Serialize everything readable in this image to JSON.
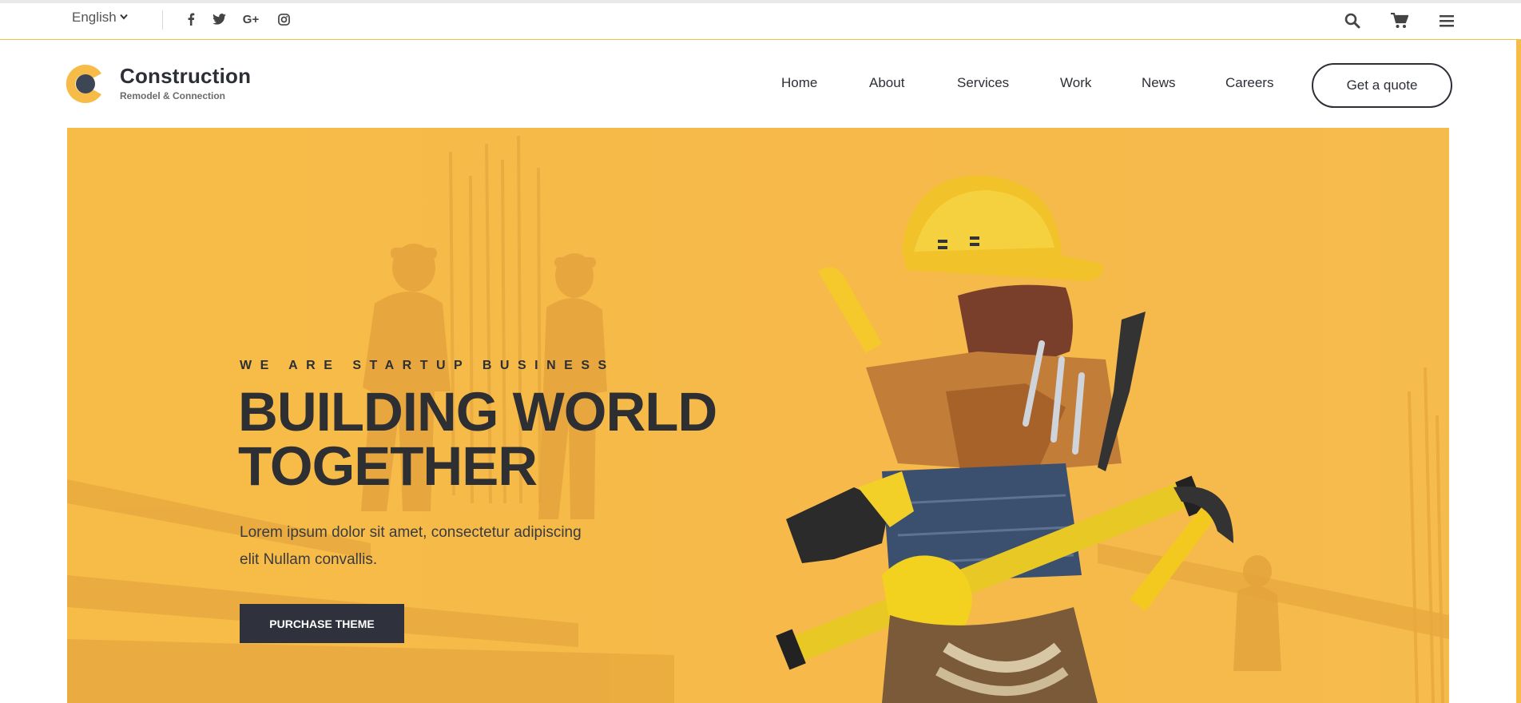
{
  "topbar": {
    "language": "English",
    "social": [
      {
        "icon": "facebook-icon",
        "glyph": "f"
      },
      {
        "icon": "twitter-icon",
        "glyph": ""
      },
      {
        "icon": "google-plus-icon",
        "glyph": "G+"
      },
      {
        "icon": "instagram-icon",
        "glyph": ""
      }
    ],
    "utility": [
      "search-icon",
      "cart-icon",
      "menu-icon"
    ]
  },
  "brand": {
    "name": "Construction",
    "tagline": "Remodel & Connection",
    "colors": {
      "accent": "#f7bc47",
      "dark": "#2c2f36",
      "logo_inner": "#3d4654"
    }
  },
  "nav": {
    "items": [
      "Home",
      "About",
      "Services",
      "Work",
      "News",
      "Careers"
    ],
    "quote_label": "Get a quote"
  },
  "hero": {
    "eyebrow": "WE ARE STARTUP BUSINESS",
    "headline_line1": "BUILDING WORLD",
    "headline_line2": "TOGETHER",
    "lead": "Lorem ipsum dolor sit amet, consectetur adipiscing elit Nullam convallis.",
    "cta_label": "PURCHASE THEME",
    "illustration": "construction-worker-tools-image",
    "background_color": "#f7bc47"
  }
}
